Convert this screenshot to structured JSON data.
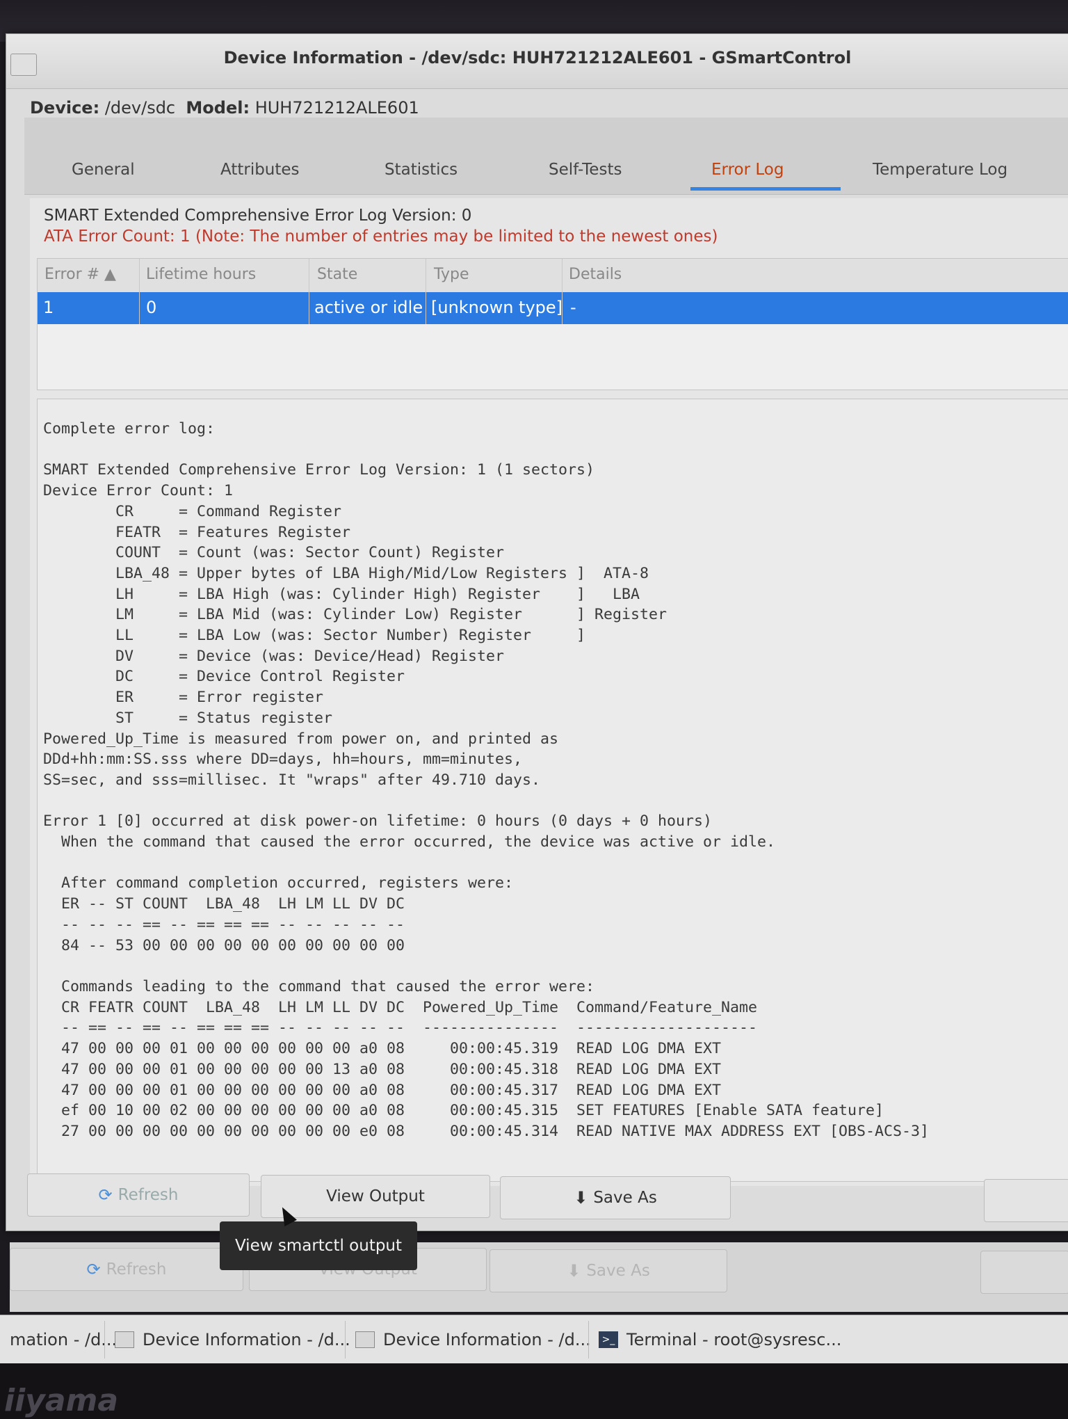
{
  "window": {
    "title": "Device Information - /dev/sdc: HUH721212ALE601 - GSmartControl",
    "device_label": "Device:",
    "device_value": "/dev/sdc",
    "model_label": "Model:",
    "model_value": "HUH721212ALE601"
  },
  "tabs": [
    {
      "label": "General"
    },
    {
      "label": "Attributes"
    },
    {
      "label": "Statistics"
    },
    {
      "label": "Self-Tests"
    },
    {
      "label": "Error Log",
      "active": true
    },
    {
      "label": "Temperature Log"
    }
  ],
  "error_log": {
    "version_line": "SMART Extended Comprehensive Error Log Version: 0",
    "count_line": "ATA Error Count: 1 (Note: The number of entries may be limited to the newest ones)",
    "columns": [
      "Error # ▲",
      "Lifetime hours",
      "State",
      "Type",
      "Details"
    ],
    "rows": [
      {
        "error": "1",
        "hours": "0",
        "state": "active or idle",
        "type": "[unknown type]",
        "details": "-"
      }
    ],
    "complete_log": "Complete error log:\n\nSMART Extended Comprehensive Error Log Version: 1 (1 sectors)\nDevice Error Count: 1\n        CR     = Command Register\n        FEATR  = Features Register\n        COUNT  = Count (was: Sector Count) Register\n        LBA_48 = Upper bytes of LBA High/Mid/Low Registers ]  ATA-8\n        LH     = LBA High (was: Cylinder High) Register    ]   LBA\n        LM     = LBA Mid (was: Cylinder Low) Register      ] Register\n        LL     = LBA Low (was: Sector Number) Register     ]\n        DV     = Device (was: Device/Head) Register\n        DC     = Device Control Register\n        ER     = Error register\n        ST     = Status register\nPowered_Up_Time is measured from power on, and printed as\nDDd+hh:mm:SS.sss where DD=days, hh=hours, mm=minutes,\nSS=sec, and sss=millisec. It \"wraps\" after 49.710 days.\n\nError 1 [0] occurred at disk power-on lifetime: 0 hours (0 days + 0 hours)\n  When the command that caused the error occurred, the device was active or idle.\n\n  After command completion occurred, registers were:\n  ER -- ST COUNT  LBA_48  LH LM LL DV DC\n  -- -- -- == -- == == == -- -- -- -- --\n  84 -- 53 00 00 00 00 00 00 00 00 00 00\n\n  Commands leading to the command that caused the error were:\n  CR FEATR COUNT  LBA_48  LH LM LL DV DC  Powered_Up_Time  Command/Feature_Name\n  -- == -- == -- == == == -- -- -- -- --  ---------------  --------------------\n  47 00 00 00 01 00 00 00 00 00 00 a0 08     00:00:45.319  READ LOG DMA EXT\n  47 00 00 00 01 00 00 00 00 00 13 a0 08     00:00:45.318  READ LOG DMA EXT\n  47 00 00 00 01 00 00 00 00 00 00 a0 08     00:00:45.317  READ LOG DMA EXT\n  ef 00 10 00 02 00 00 00 00 00 00 a0 08     00:00:45.315  SET FEATURES [Enable SATA feature]\n  27 00 00 00 00 00 00 00 00 00 00 e0 08     00:00:45.314  READ NATIVE MAX ADDRESS EXT [OBS-ACS-3]"
  },
  "buttons": {
    "refresh": "Refresh",
    "view_output": "View Output",
    "save_as": "Save As"
  },
  "tooltip": "View smartctl output",
  "ghost_buttons": {
    "refresh": "Refresh",
    "view_output": "View Output",
    "save_as": "Save As"
  },
  "taskbar": [
    {
      "label": "mation - /d...",
      "icon": "window-icon"
    },
    {
      "label": "Device Information - /d...",
      "icon": "window-icon"
    },
    {
      "label": "Device Information - /d...",
      "icon": "window-icon"
    },
    {
      "label": "Terminal - root@sysresc...",
      "icon": "terminal-icon"
    }
  ],
  "bezel_brand": "iiyama",
  "colors": {
    "accent": "#3584e4",
    "selection": "#2a7ae2",
    "active_tab": "#c2410c",
    "warning_text": "#c0392b"
  }
}
